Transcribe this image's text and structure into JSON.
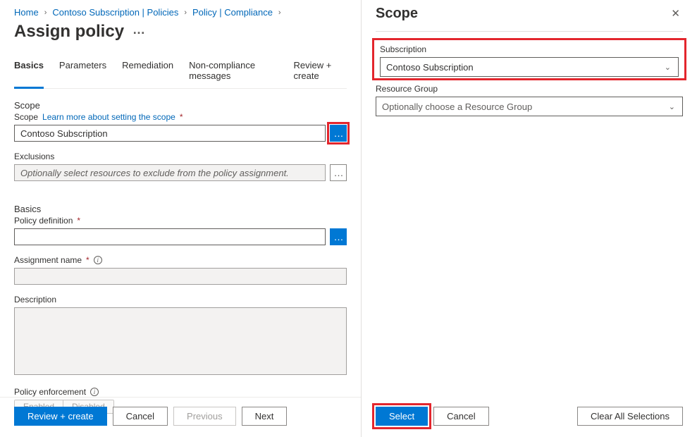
{
  "breadcrumb": {
    "home": "Home",
    "subscription": "Contoso Subscription | Policies",
    "compliance": "Policy | Compliance"
  },
  "page_title": "Assign policy",
  "tabs": {
    "basics": "Basics",
    "parameters": "Parameters",
    "remediation": "Remediation",
    "noncompliance": "Non-compliance messages",
    "review": "Review + create"
  },
  "scope": {
    "section": "Scope",
    "label": "Scope",
    "learn_more": "Learn more about setting the scope",
    "value": "Contoso Subscription",
    "exclusions_label": "Exclusions",
    "exclusions_placeholder": "Optionally select resources to exclude from the policy assignment."
  },
  "basics": {
    "section": "Basics",
    "policy_def_label": "Policy definition",
    "assignment_name_label": "Assignment name",
    "description_label": "Description",
    "enforcement_label": "Policy enforcement",
    "enabled": "Enabled",
    "disabled": "Disabled"
  },
  "left_actions": {
    "review_create": "Review + create",
    "cancel": "Cancel",
    "previous": "Previous",
    "next": "Next"
  },
  "right_panel": {
    "title": "Scope",
    "subscription_label": "Subscription",
    "subscription_value": "Contoso Subscription",
    "rg_label": "Resource Group",
    "rg_placeholder": "Optionally choose a Resource Group",
    "select": "Select",
    "cancel": "Cancel",
    "clear": "Clear All Selections"
  }
}
